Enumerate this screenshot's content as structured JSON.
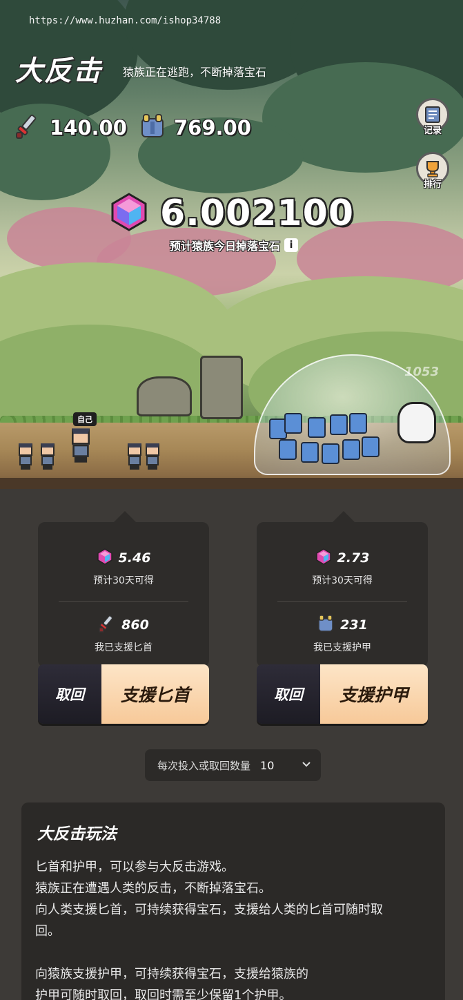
{
  "watermark": "https://www.huzhan.com/ishop34788",
  "header": {
    "title": "大反击",
    "subtitle": "猿族正在逃跑，不断掉落宝石"
  },
  "stats": {
    "dagger_total": "140.00",
    "armor_total": "769.00"
  },
  "side_buttons": {
    "records_label": "记录",
    "ranking_label": "排行"
  },
  "gem_forecast": {
    "value": "6.002100",
    "caption": "预计猿族今日掉落宝石",
    "info": "i"
  },
  "scene": {
    "self_label": "自己",
    "damage_number": "1053"
  },
  "cards": [
    {
      "gem_value": "5.46",
      "gem_caption": "预计30天可得",
      "support_value": "860",
      "support_caption": "我已支援匕首",
      "recall_label": "取回",
      "support_label": "支援匕首",
      "support_icon": "dagger-icon"
    },
    {
      "gem_value": "2.73",
      "gem_caption": "预计30天可得",
      "support_value": "231",
      "support_caption": "我已支援护甲",
      "recall_label": "取回",
      "support_label": "支援护甲",
      "support_icon": "armor-icon"
    }
  ],
  "amount_select": {
    "label": "每次投入或取回数量",
    "value": "10"
  },
  "rules": {
    "title": "大反击玩法",
    "lines": [
      "匕首和护甲，可以参与大反击游戏。",
      "猿族正在遭遇人类的反击，不断掉落宝石。",
      "向人类支援匕首，可持续获得宝石，支援给人类的匕首可随时取",
      "回。",
      "",
      "向猿族支援护甲，可持续获得宝石，支援给猿族的",
      "护甲可随时取回，取回时需至少保留1个护甲。"
    ]
  },
  "colors": {
    "panel_bg": "#3d3a37",
    "card_bg": "#2e2c2a",
    "support_button": "#f7c999",
    "recall_button": "#1d1c24"
  }
}
